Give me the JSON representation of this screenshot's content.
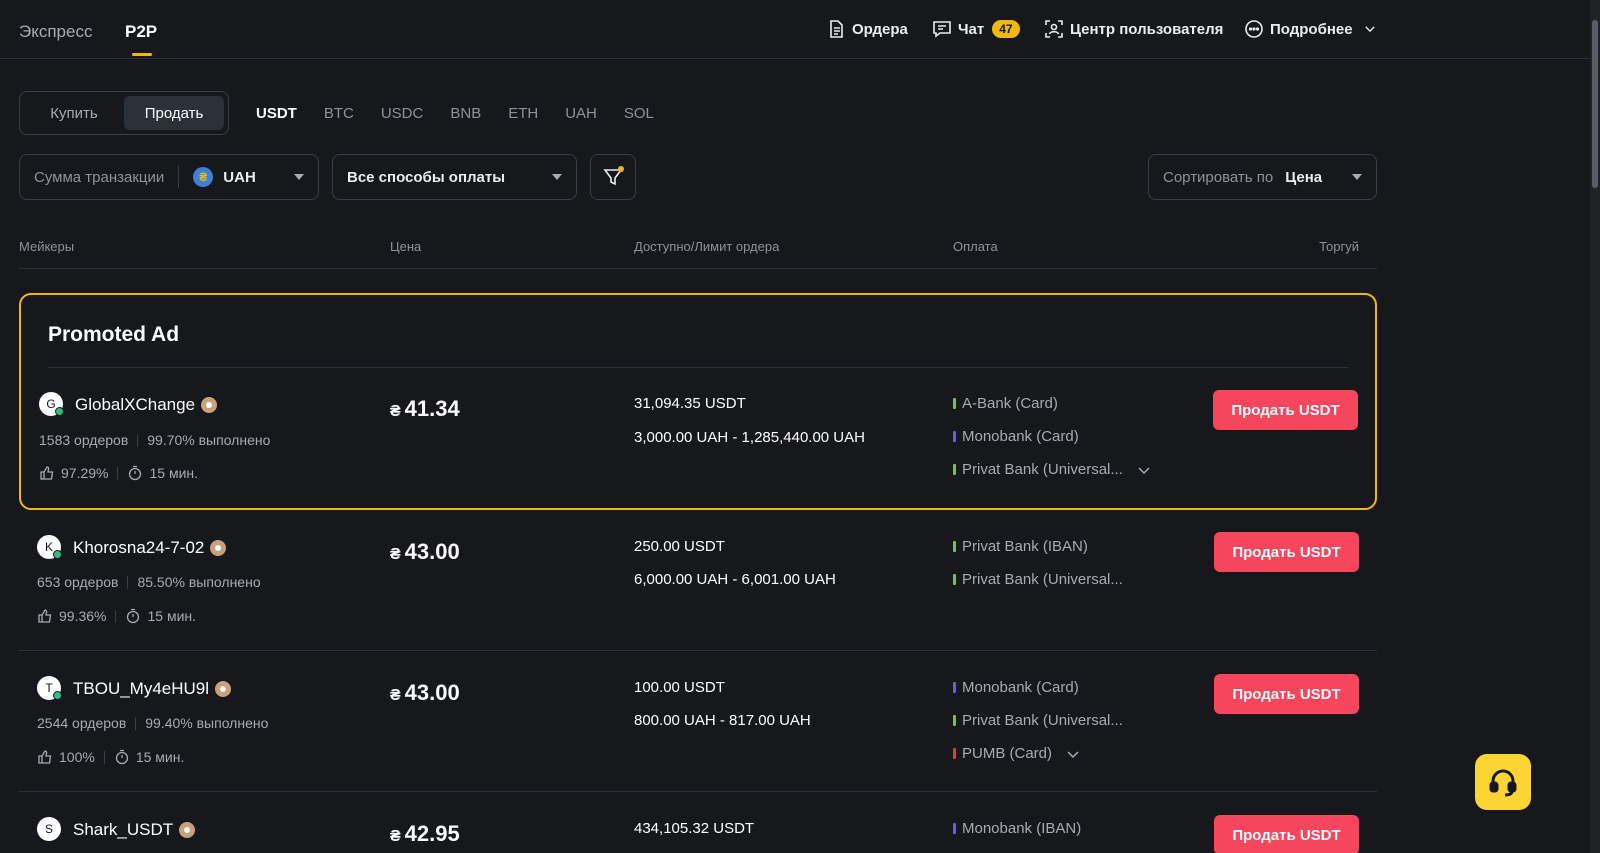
{
  "topnav": {
    "tabs": [
      "Экспресс",
      "P2P"
    ],
    "orders_label": "Ордера",
    "chat_label": "Чат",
    "chat_count": "47",
    "user_center_label": "Центр пользователя",
    "more_label": "Подробнее"
  },
  "mode": {
    "buy": "Купить",
    "sell": "Продать",
    "active": "sell"
  },
  "coins": [
    "USDT",
    "BTC",
    "USDC",
    "BNB",
    "ETH",
    "UAH",
    "SOL"
  ],
  "filters": {
    "amount_label": "Сумма транзакции",
    "currency_symbol": "₴",
    "currency": "UAH",
    "payment": "Все способы оплаты",
    "sort_label": "Сортировать по",
    "sort_value": "Цена"
  },
  "table_headers": {
    "makers": "Мейкеры",
    "price": "Цена",
    "available": "Доступно/Лимит ордера",
    "payment": "Оплата",
    "trade": "Торгуй"
  },
  "promo_title": "Promoted Ad",
  "price_symbol": "₴",
  "rows": [
    {
      "initial": "G",
      "name": "GlobalXChange",
      "orders": "1583 ордеров",
      "completion": "99.70% выполнено",
      "rating": "97.29%",
      "time": "15 мин.",
      "price": "41.34",
      "available": "31,094.35 USDT",
      "limit": "3,000.00 UAH - 1,285,440.00 UAH",
      "payments": [
        {
          "name": "A-Bank (Card)",
          "color": "#7ec13f"
        },
        {
          "name": "Monobank (Card)",
          "color": "#6c5ce7"
        },
        {
          "name": "Privat Bank (Universal...",
          "color": "#7ec13f"
        }
      ],
      "button": "Продать USDT"
    },
    {
      "initial": "K",
      "name": "Khorosna24-7-02",
      "orders": "653 ордеров",
      "completion": "85.50% выполнено",
      "rating": "99.36%",
      "time": "15 мин.",
      "price": "43.00",
      "available": "250.00 USDT",
      "limit": "6,000.00 UAH - 6,001.00 UAH",
      "payments": [
        {
          "name": "Privat Bank (IBAN)",
          "color": "#7ec13f"
        },
        {
          "name": "Privat Bank (Universal...",
          "color": "#7ec13f"
        }
      ],
      "button": "Продать USDT"
    },
    {
      "initial": "T",
      "name": "TBOU_My4eHU9l",
      "orders": "2544 ордеров",
      "completion": "99.40% выполнено",
      "rating": "100%",
      "time": "15 мин.",
      "price": "43.00",
      "available": "100.00 USDT",
      "limit": "800.00 UAH - 817.00 UAH",
      "payments": [
        {
          "name": "Monobank (Card)",
          "color": "#6c5ce7"
        },
        {
          "name": "Privat Bank (Universal...",
          "color": "#7ec13f"
        },
        {
          "name": "PUMB (Card)",
          "color": "#e53935"
        }
      ],
      "button": "Продать USDT"
    },
    {
      "initial": "S",
      "name": "Shark_USDT",
      "price": "42.95",
      "available": "434,105.32 USDT",
      "payments": [
        {
          "name": "Monobank (IBAN)",
          "color": "#6c5ce7"
        }
      ],
      "button": "Продать USDT"
    }
  ]
}
